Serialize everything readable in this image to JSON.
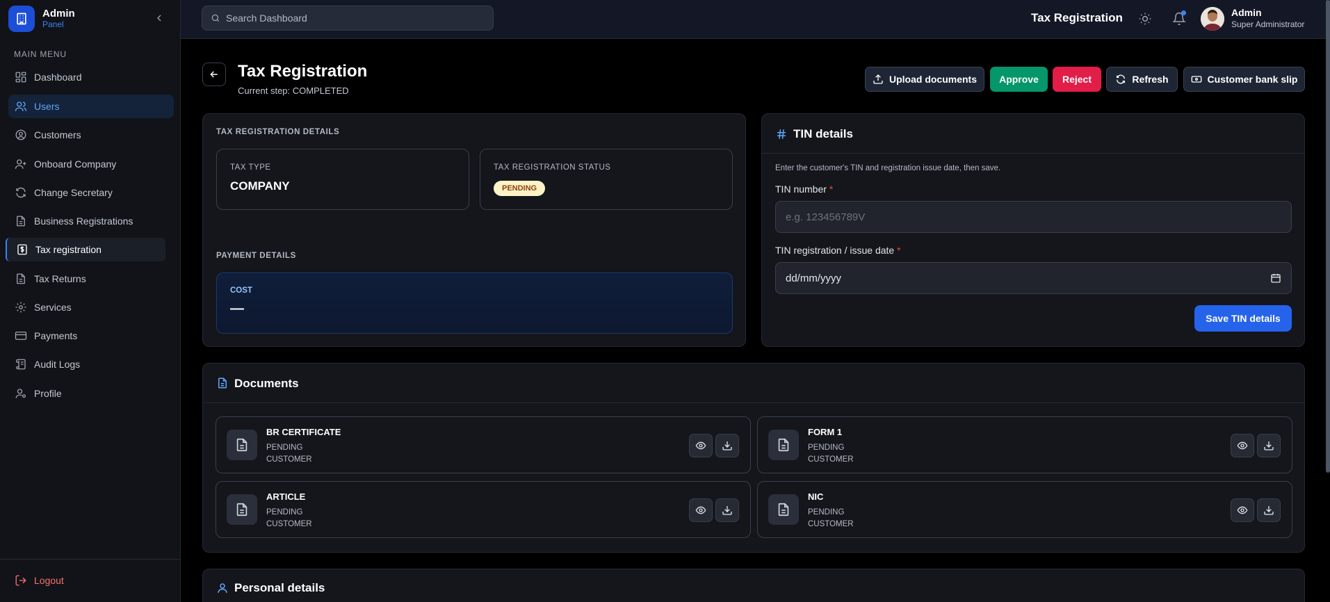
{
  "brand": {
    "title": "Admin",
    "subtitle": "Panel"
  },
  "sidebar": {
    "heading": "MAIN MENU",
    "items": [
      {
        "label": "Dashboard",
        "icon": "dashboard-icon"
      },
      {
        "label": "Users",
        "icon": "users-icon"
      },
      {
        "label": "Customers",
        "icon": "customer-icon"
      },
      {
        "label": "Onboard Company",
        "icon": "user-plus-icon"
      },
      {
        "label": "Change Secretary",
        "icon": "refresh-icon"
      },
      {
        "label": "Business Registrations",
        "icon": "file-icon"
      },
      {
        "label": "Tax registration",
        "icon": "tax-icon"
      },
      {
        "label": "Tax Returns",
        "icon": "file-icon"
      },
      {
        "label": "Services",
        "icon": "gear-icon"
      },
      {
        "label": "Payments",
        "icon": "credit-card-icon"
      },
      {
        "label": "Audit Logs",
        "icon": "scroll-icon"
      },
      {
        "label": "Profile",
        "icon": "user-gear-icon"
      }
    ],
    "logout": "Logout"
  },
  "topbar": {
    "search_placeholder": "Search Dashboard",
    "title": "Tax Registration",
    "user_name": "Admin",
    "user_role": "Super Administrator"
  },
  "page": {
    "title": "Tax Registration",
    "subtitle": "Current step: COMPLETED",
    "actions": {
      "upload": "Upload documents",
      "approve": "Approve",
      "reject": "Reject",
      "refresh": "Refresh",
      "bank_slip": "Customer bank slip"
    }
  },
  "details": {
    "heading": "TAX REGISTRATION DETAILS",
    "tax_type_label": "TAX TYPE",
    "tax_type_value": "COMPANY",
    "status_label": "TAX REGISTRATION STATUS",
    "status_value": "PENDING",
    "payment_heading": "PAYMENT DETAILS",
    "cost_label": "COST",
    "cost_value": "—"
  },
  "tin": {
    "title": "TIN details",
    "hint": "Enter the customer's TIN and registration issue date, then save.",
    "number_label": "TIN number",
    "number_placeholder": "e.g. 123456789V",
    "date_label": "TIN registration / issue date",
    "date_value": "dd/mm/yyyy",
    "required_mark": "*",
    "save": "Save TIN details"
  },
  "documents": {
    "title": "Documents",
    "items": [
      {
        "name": "BR CERTIFICATE",
        "status": "PENDING",
        "owner": "CUSTOMER"
      },
      {
        "name": "FORM 1",
        "status": "PENDING",
        "owner": "CUSTOMER"
      },
      {
        "name": "ARTICLE",
        "status": "PENDING",
        "owner": "CUSTOMER"
      },
      {
        "name": "NIC",
        "status": "PENDING",
        "owner": "CUSTOMER"
      }
    ]
  },
  "personal": {
    "title": "Personal details"
  },
  "colors": {
    "accent": "#2563eb",
    "approve": "#059669",
    "reject": "#e11d48",
    "badge_bg": "#fef3c7"
  }
}
